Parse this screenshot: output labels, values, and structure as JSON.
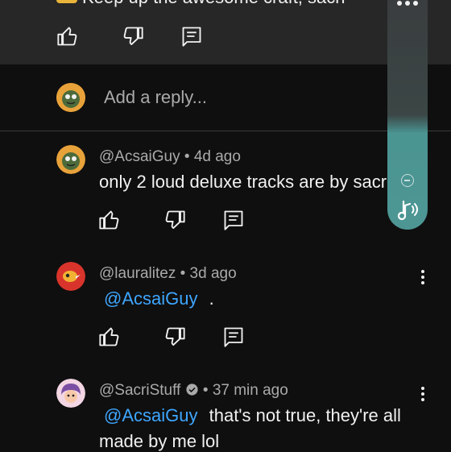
{
  "top_comment": {
    "text": "Keep up the awesome craft, sacri",
    "actions": {
      "like": "like",
      "dislike": "dislike",
      "reply": "reply"
    }
  },
  "reply_box": {
    "placeholder": "Add a reply..."
  },
  "comments": [
    {
      "handle": "@AcsaiGuy",
      "separator": "•",
      "time": "4d ago",
      "text": "only 2 loud deluxe tracks are by sacr"
    },
    {
      "handle": "@lauralitez",
      "separator": "•",
      "time": "3d ago",
      "mention": "@AcsaiGuy",
      "text": "."
    },
    {
      "handle": "@SacriStuff",
      "separator": "•",
      "time": "37 min ago",
      "verified": true,
      "mention": "@AcsaiGuy",
      "text_line1": "that's not true, they're all",
      "text_line2": "made by me lol"
    }
  ],
  "colors": {
    "background": "#0f0f0f",
    "top_block": "#272727",
    "mention": "#3ea6ff",
    "meta": "#aaaaaa",
    "panel_accent": "#4d9694"
  },
  "icons": [
    "thumbs-up-icon",
    "thumbs-down-icon",
    "reply-icon",
    "more-vert-icon",
    "verified-icon",
    "music-note-icon"
  ]
}
